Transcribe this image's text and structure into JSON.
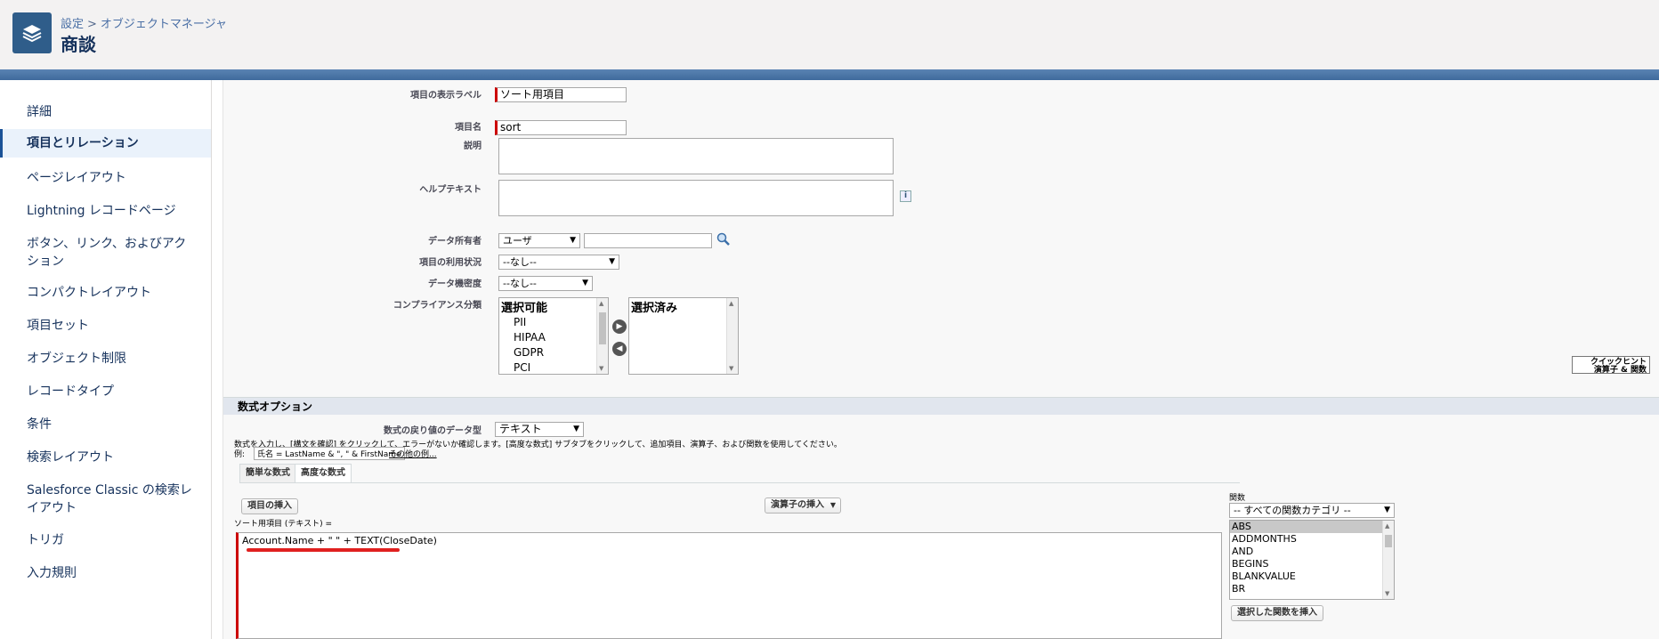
{
  "header": {
    "breadcrumb_settings": "設定",
    "breadcrumb_sep": ">",
    "breadcrumb_object_manager": "オブジェクトマネージャ",
    "title": "商談",
    "icon": "layers-icon"
  },
  "sidebar": {
    "items": [
      {
        "label": "詳細"
      },
      {
        "label": "項目とリレーション"
      },
      {
        "label": "ページレイアウト"
      },
      {
        "label": "Lightning レコードページ"
      },
      {
        "label": "ボタン、リンク、およびアクション"
      },
      {
        "label": "コンパクトレイアウト"
      },
      {
        "label": "項目セット"
      },
      {
        "label": "オブジェクト制限"
      },
      {
        "label": "レコードタイプ"
      },
      {
        "label": "条件"
      },
      {
        "label": "検索レイアウト"
      },
      {
        "label": "Salesforce Classic の検索レイアウト"
      },
      {
        "label": "トリガ"
      },
      {
        "label": "入力規則"
      }
    ]
  },
  "form": {
    "label_label": "項目の表示ラベル",
    "label_value": "ソート用項目",
    "name_label": "項目名",
    "name_value": "sort",
    "desc_label": "説明",
    "help_label": "ヘルプテキスト",
    "info_icon": "info-icon",
    "owner_label": "データ所有者",
    "owner_type": "ユーザ",
    "lookup_icon": "lookup-icon",
    "usage_label": "項目の利用状況",
    "usage_value": "--なし--",
    "sensitivity_label": "データ機密度",
    "sensitivity_value": "--なし--",
    "compliance_label": "コンプライアンス分類",
    "available_header": "選択可能",
    "available_items": [
      "PII",
      "HIPAA",
      "GDPR",
      "PCI"
    ],
    "selected_header": "選択済み"
  },
  "formula": {
    "section_title": "数式オプション",
    "return_type_label": "数式の戻り値のデータ型",
    "return_type_value": "テキスト",
    "instruction": "数式を入力し、[構文を確認] をクリックして、エラーがないか確認します。[高度な数式] サブタブをクリックして、追加項目、演算子、および関数を使用してください。",
    "example_label": "例:",
    "example_value": "氏名 = LastName & \", \" & FirstName",
    "more_examples_link": "その他の例...",
    "quick_hint_line1": "クイックヒント",
    "quick_hint_line2": "演算子 & 関数",
    "tab_simple": "簡単な数式",
    "tab_advanced": "高度な数式",
    "insert_field_button": "項目の挿入",
    "insert_operator_button": "演算子の挿入",
    "editor_label": "ソート用項目 (テキスト) =",
    "editor_value": "Account.Name  + \" \" + TEXT(CloseDate)",
    "functions_label": "関数",
    "function_category": "-- すべての関数カテゴリ --",
    "functions": [
      "ABS",
      "ADDMONTHS",
      "AND",
      "BEGINS",
      "BLANKVALUE",
      "BR"
    ],
    "insert_function_button": "選択した関数を挿入"
  }
}
